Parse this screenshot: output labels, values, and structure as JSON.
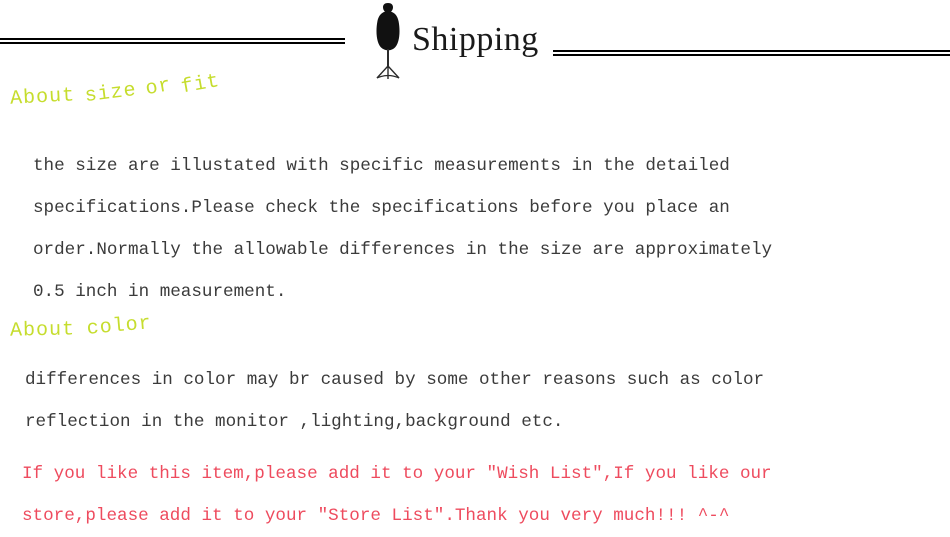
{
  "header": {
    "title": "Shipping",
    "icon": "mannequin-dress-form-icon",
    "rule_color": "#000000"
  },
  "sections": [
    {
      "heading": "About size or fit",
      "heading_words": [
        "About",
        "size",
        "or",
        "fit"
      ],
      "heading_color": "#c6dd2e",
      "lines": [
        "the size are illustated with specific measurements in the detailed",
        "specifications.Please check the specifications before you place an",
        "order.Normally the allowable differences in the size are approximately",
        "0.5 inch in measurement."
      ]
    },
    {
      "heading": "About color",
      "heading_words": [
        "About",
        "color"
      ],
      "heading_color": "#c6dd2e",
      "lines": [
        "differences in color may br caused by some other reasons such as color",
        "reflection in the monitor ,lighting,background etc."
      ]
    }
  ],
  "promo": {
    "color": "#ee4b5e",
    "lines": [
      "If you like this item,please add it to your \"Wish List\",If you like our",
      "store,please add it to your \"Store List\".Thank you very much!!! ^-^"
    ]
  }
}
